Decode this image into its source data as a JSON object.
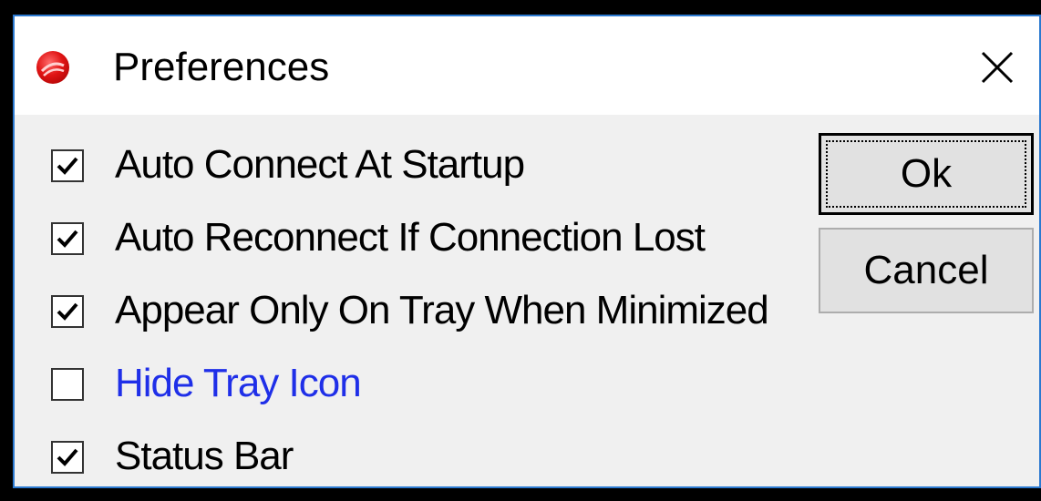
{
  "window": {
    "title": "Preferences",
    "app_icon": "red-globe-icon",
    "close_icon": "close-icon",
    "accent_color": "#2b79d0"
  },
  "options": [
    {
      "label": "Auto Connect At Startup",
      "checked": true
    },
    {
      "label": "Auto Reconnect If Connection Lost",
      "checked": true
    },
    {
      "label": "Appear Only On Tray When Minimized",
      "checked": true
    },
    {
      "label": "Hide Tray Icon",
      "checked": false,
      "color": "#1f2fe8"
    },
    {
      "label": "Status Bar",
      "checked": true
    }
  ],
  "buttons": {
    "ok_label": "Ok",
    "cancel_label": "Cancel"
  }
}
